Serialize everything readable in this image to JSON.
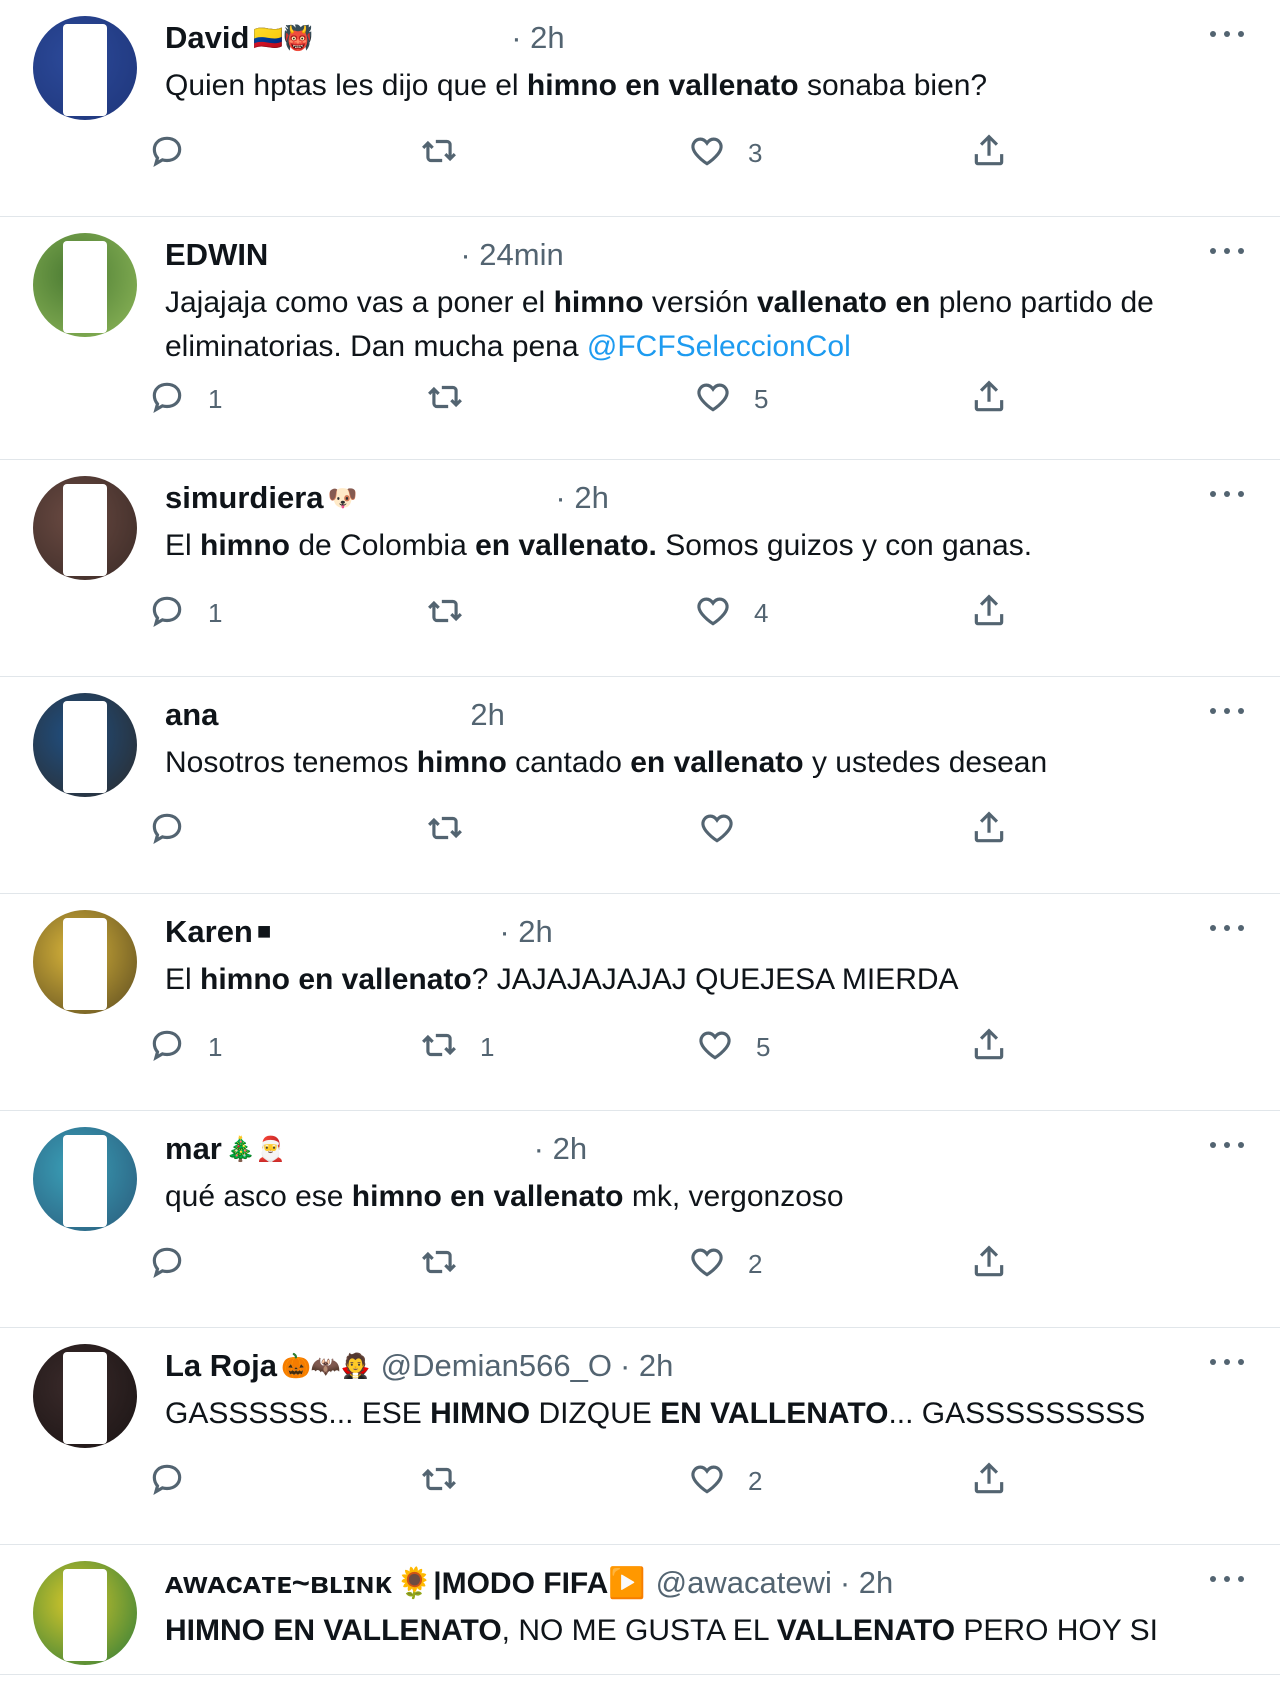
{
  "tweets": [
    {
      "name": "David",
      "emoji": "🇨🇴👹",
      "handle": "",
      "time": "· 2h",
      "avatar_colors": [
        "#2c4a9a",
        "#1e3579"
      ],
      "text_parts": [
        {
          "t": "Quien hptas les dijo que el ",
          "b": false
        },
        {
          "t": "himno en vallenato",
          "b": true
        },
        {
          "t": " sonaba bien?",
          "b": false
        }
      ],
      "reply": "",
      "retweet": "",
      "like": "3"
    },
    {
      "name": "EDWIN",
      "emoji": "",
      "handle": "",
      "time": "· 24min",
      "avatar_colors": [
        "#4a7a32",
        "#8fb85a"
      ],
      "text_parts": [
        {
          "t": "Jajajaja como vas a poner el ",
          "b": false
        },
        {
          "t": "himno",
          "b": true
        },
        {
          "t": " versión ",
          "b": false
        },
        {
          "t": "vallenato en",
          "b": true
        },
        {
          "t": " pleno partido de eliminatorias. Dan mucha pena ",
          "b": false
        },
        {
          "t": "@FCFSeleccionCol",
          "b": false,
          "mention": true
        }
      ],
      "reply": "1",
      "retweet": "",
      "like": "5"
    },
    {
      "name": "simurdiera",
      "emoji": "🐶",
      "handle": "",
      "time": "· 2h",
      "avatar_colors": [
        "#6a4a42",
        "#3a2a26"
      ],
      "text_parts": [
        {
          "t": "El ",
          "b": false
        },
        {
          "t": "himno",
          "b": true
        },
        {
          "t": " de Colombia ",
          "b": false
        },
        {
          "t": "en vallenato.",
          "b": true
        },
        {
          "t": " Somos guizos y con ganas.",
          "b": false
        }
      ],
      "reply": "1",
      "retweet": "",
      "like": "4"
    },
    {
      "name": "ana",
      "emoji": "",
      "handle": "",
      "time": "2h",
      "avatar_colors": [
        "#1f4f82",
        "#2b2b2b"
      ],
      "text_parts": [
        {
          "t": "Nosotros tenemos ",
          "b": false
        },
        {
          "t": "himno",
          "b": true
        },
        {
          "t": " cantado ",
          "b": false
        },
        {
          "t": "en vallenato",
          "b": true
        },
        {
          "t": " y ustedes desean",
          "b": false
        }
      ],
      "reply": "",
      "retweet": "",
      "like": ""
    },
    {
      "name": "Karen",
      "emoji": "■",
      "handle": "",
      "time": "· 2h",
      "avatar_colors": [
        "#d8b43a",
        "#5a4a20"
      ],
      "text_parts": [
        {
          "t": "El ",
          "b": false
        },
        {
          "t": "himno en vallenato",
          "b": true
        },
        {
          "t": "? JAJAJAJAJAJ QUEJESA MIERDA",
          "b": false
        }
      ],
      "reply": "1",
      "retweet": "1",
      "like": "5"
    },
    {
      "name": "mar",
      "emoji": "🎄🎅",
      "handle": "",
      "time": "· 2h",
      "avatar_colors": [
        "#3aa0b8",
        "#2a5a7a"
      ],
      "text_parts": [
        {
          "t": "qué asco ese ",
          "b": false
        },
        {
          "t": "himno en vallenato",
          "b": true
        },
        {
          "t": " mk, vergonzoso",
          "b": false
        }
      ],
      "reply": "",
      "retweet": "",
      "like": "2"
    },
    {
      "name": "La Roja",
      "emoji": "🎃🦇🧛",
      "handle": "@Demian566_O",
      "time": "· 2h",
      "avatar_colors": [
        "#3a2a2a",
        "#1a1414"
      ],
      "text_parts": [
        {
          "t": "GASSSSSS... ESE ",
          "b": false
        },
        {
          "t": "HIMNO",
          "b": true
        },
        {
          "t": " DIZQUE ",
          "b": false
        },
        {
          "t": "EN VALLENATO",
          "b": true
        },
        {
          "t": "... GASSSSSSSSS",
          "b": false
        }
      ],
      "reply": "",
      "retweet": "",
      "like": "2"
    },
    {
      "name": "ᴀᴡᴀᴄᴀᴛᴇ~ʙʟɪɴᴋ",
      "emoji": "🌻|MODO FIFA▶️",
      "handle": "@awacatewi",
      "time": "· 2h",
      "avatar_colors": [
        "#d8c82a",
        "#2a7a3a"
      ],
      "text_parts": [
        {
          "t": "HIMNO EN VALLENATO",
          "b": true
        },
        {
          "t": ", NO ME GUSTA EL ",
          "b": false
        },
        {
          "t": "VALLENATO",
          "b": true
        },
        {
          "t": " PERO HOY SI",
          "b": false
        }
      ],
      "reply": "",
      "retweet": "",
      "like": ""
    }
  ]
}
